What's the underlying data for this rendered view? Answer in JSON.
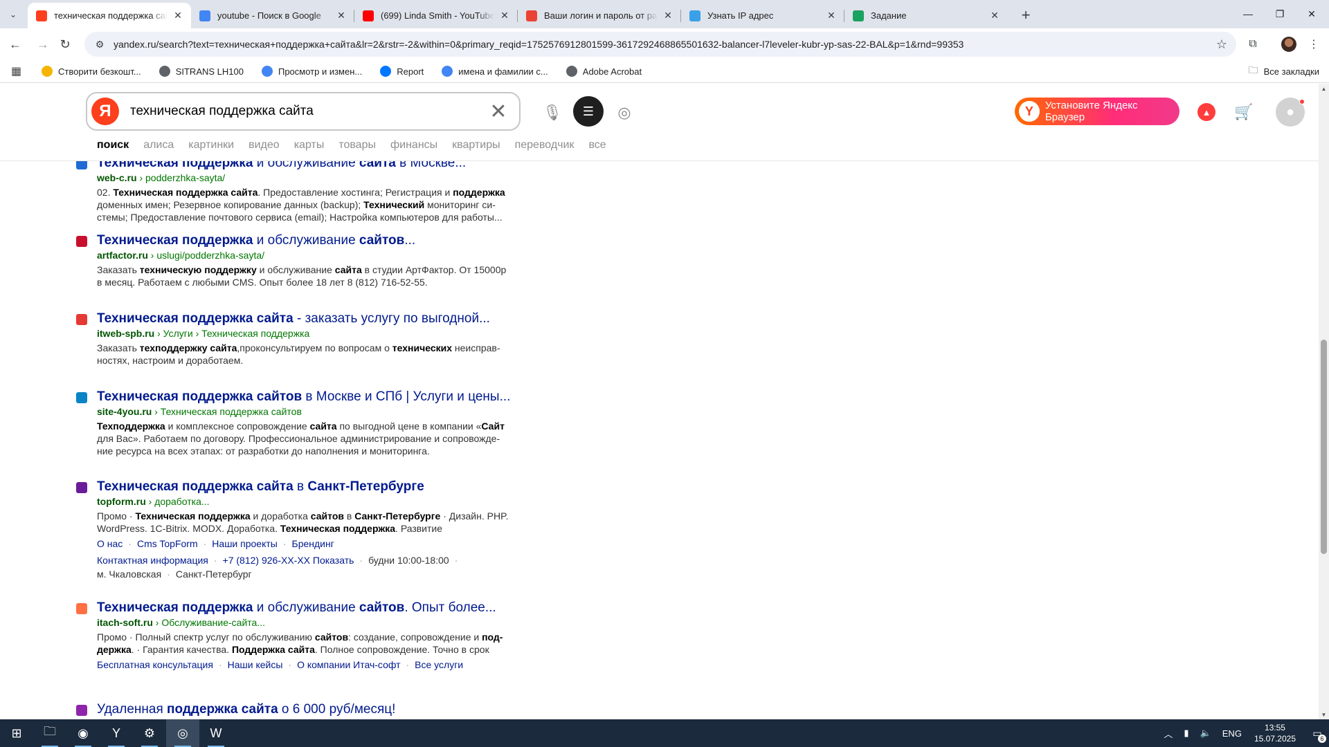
{
  "tabs": [
    {
      "title": "техническая поддержка сайта",
      "active": true,
      "icon": "yandex-icon",
      "color": "#fc3f1d"
    },
    {
      "title": "youtube - Поиск в Google",
      "active": false,
      "icon": "google-icon",
      "color": "#4285f4"
    },
    {
      "title": "(699) Linda Smith - YouTube",
      "active": false,
      "icon": "youtube-icon",
      "color": "#ff0000"
    },
    {
      "title": "Ваши логин и пароль от расш",
      "active": false,
      "icon": "gmail-icon",
      "color": "#ea4335"
    },
    {
      "title": "Узнать IP адрес",
      "active": false,
      "icon": "ip-icon",
      "color": "#3aa0e8"
    },
    {
      "title": "Задание",
      "active": false,
      "icon": "task-icon",
      "color": "#1aa260"
    }
  ],
  "omnibox": {
    "url": "yandex.ru/search?text=техническая+поддержка+сайта&lr=2&rstr=-2&within=0&primary_reqid=1752576912801599-3617292468865501632-balancer-l7leveler-kubr-yp-sas-22-BAL&p=1&rnd=99353"
  },
  "bookmarks": [
    {
      "label": "Створити безкошт...",
      "icon": "star-badge-icon",
      "color": "#f4b400"
    },
    {
      "label": "SITRANS LH100",
      "icon": "globe-icon",
      "color": "#5f6368"
    },
    {
      "label": "Просмотр и измен...",
      "icon": "google-icon",
      "color": "#4285f4"
    },
    {
      "label": "Report",
      "icon": "vk-icon",
      "color": "#0077ff"
    },
    {
      "label": "имена и фамилии с...",
      "icon": "google-icon",
      "color": "#4285f4"
    },
    {
      "label": "Adobe Acrobat",
      "icon": "globe-icon",
      "color": "#5f6368"
    }
  ],
  "all_bookmarks": "Все закладки",
  "search": {
    "query": "техническая поддержка сайта",
    "logo": "Я",
    "promo": "Установите Яндекс Браузер",
    "services": [
      "поиск",
      "алиса",
      "картинки",
      "видео",
      "карты",
      "товары",
      "финансы",
      "квартиры",
      "переводчик",
      "все"
    ]
  },
  "results": [
    {
      "title_html": "<b>Техническая поддержка</b> и обслуживание <b>сайта</b> в Москве...",
      "url_html": "<b>web-c.ru</b> › podderzhka-sayta/",
      "snippet_html": "02. <b>Техническая поддержка сайта</b>. Предоставление хостинга; Регистрация и <b>поддержка</b> доменных имен; Резервное копирование данных (backup); <b>Технический</b> мониторинг си­стемы; Предоставление почтового сервиса (email); Настройка компьютеров для работы...",
      "favicon": "web-c-icon",
      "color": "#1e6bd6"
    },
    {
      "title_html": "<b>Техническая поддержка</b> и обслуживание <b>сайтов</b>...",
      "url_html": "<b>artfactor.ru</b> › uslugi/podderzhka-sayta/",
      "snippet_html": "Заказать <b>техническую поддержку</b> и обслуживание <b>сайта</b> в студии АртФактор. От 15000р в месяц. Работаем с любыми CMS. Опыт более 18 лет 8 (812) 716-52-55.",
      "favicon": "artfactor-icon",
      "color": "#c8102e"
    },
    {
      "title_html": "<b>Техническая поддержка сайта</b> - заказать услугу по выгодной...",
      "url_html": "<b>itweb-spb.ru</b> › Услуги › Техническая поддержка",
      "snippet_html": "Заказать <b>техподдержку сайта</b>,проконсультируем по вопросам о <b>технических</b> неисправ­ностях, настроим и доработаем.",
      "favicon": "itweb-icon",
      "color": "#e53935"
    },
    {
      "title_html": "<b>Техническая поддержка сайтов</b> в Москве и СПб | Услуги и цены...",
      "url_html": "<b>site-4you.ru</b> › Техническая поддержка сайтов",
      "snippet_html": "<b>Техподдержка</b> и комплексное сопровождение <b>сайта</b> по выгодной цене в компании «<b>Сайт</b> для Вас». Работаем по договору. Профессиональное администрирование и сопровожде­ние ресурса на всех этапах: от разработки до наполнения и мониторинга.",
      "favicon": "site4you-icon",
      "color": "#0a84c6"
    },
    {
      "title_html": "<b>Техническая поддержка сайта</b> в <b>Санкт-Петербурге</b>",
      "url_html": "<b>topform.ru</b> › доработка...",
      "snippet_html": "Промо · <b>Техническая поддержка</b> и доработка <b>сайтов</b> в <b>Санкт-Петербурге</b> · Дизайн. PHP. WordPress. 1C-Bitrix. MODX. Доработка. <b>Техническая поддержка</b>. Развитие",
      "links": [
        "О нас",
        "Cms TopForm",
        "Наши проекты",
        "Брендинг"
      ],
      "links2": [
        "Контактная информация",
        "+7 (812) 926-XX-XX Показать"
      ],
      "hours": "будни 10:00-18:00",
      "meta": [
        "м. Чкаловская",
        "Санкт-Петербург"
      ],
      "favicon": "topform-icon",
      "color": "#6a1b9a"
    },
    {
      "title_html": "<b>Техническая поддержка</b> и обслуживание <b>сайтов</b>. Опыт более...",
      "url_html": "<b>itach-soft.ru</b> › Обслуживание-сайта...",
      "snippet_html": "Промо · Полный спектр услуг по обслуживанию <b>сайтов</b>: создание, сопровождение и <b>под­держка</b>. · Гарантия качества. <b>Поддержка сайта</b>. Полное сопровождение. Точно в срок",
      "links": [
        "Бесплатная консультация",
        "Наши кейсы",
        "О компании Итач-софт",
        "Все услуги"
      ],
      "favicon": "itach-icon",
      "color": "#ff7043"
    },
    {
      "title_html": "Удаленная <b>поддержка сайта</b> о 6 000 руб/месяц!",
      "url_html": "",
      "snippet_html": "",
      "favicon": "remote-icon",
      "color": "#8e24aa"
    }
  ],
  "taskbar": {
    "apps": [
      {
        "name": "file-explorer-icon",
        "glyph": "🗀",
        "running": true
      },
      {
        "name": "firefox-icon",
        "glyph": "◉",
        "running": true
      },
      {
        "name": "yandex-browser-icon",
        "glyph": "Y",
        "running": true
      },
      {
        "name": "app-icon",
        "glyph": "⚙",
        "running": true
      },
      {
        "name": "chrome-icon",
        "glyph": "◎",
        "running": true,
        "current": true
      },
      {
        "name": "word-icon",
        "glyph": "W",
        "running": true
      }
    ],
    "lang": "ENG",
    "time": "13:55",
    "date": "15.07.2025",
    "notifications": "6"
  }
}
